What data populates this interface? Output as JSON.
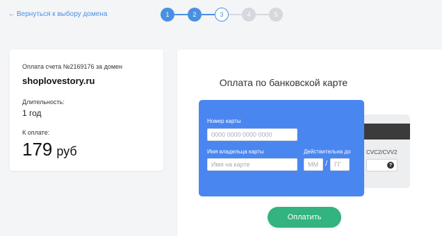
{
  "header": {
    "back_arrow": "←",
    "back_label": "Вернуться к выбору домена"
  },
  "stepper": {
    "steps": [
      {
        "label": "1",
        "state": "done"
      },
      {
        "label": "2",
        "state": "done"
      },
      {
        "label": "3",
        "state": "current"
      },
      {
        "label": "4",
        "state": "future"
      },
      {
        "label": "5",
        "state": "future"
      }
    ],
    "current_step": 3
  },
  "summary": {
    "invoice_text": "Оплата счета №2169176 за домен",
    "domain": "shoplovestory.ru",
    "duration_label": "Длительность:",
    "duration_value": "1 год",
    "to_pay_label": "К оплате:",
    "amount": "179",
    "currency": "руб"
  },
  "payment": {
    "title": "Оплата по банковской карте",
    "card_number_label": "Номер карты",
    "card_number_placeholder": "0000 0000 0000 0000",
    "holder_label": "Имя владельца карты",
    "holder_placeholder": "Имя на карте",
    "valid_label": "Действительна до",
    "month_placeholder": "ММ",
    "separator": "/",
    "year_placeholder": "ГГ",
    "cvc_label": "CVC2/CVV2",
    "help_glyph": "?",
    "pay_button": "Оплатить"
  },
  "colors": {
    "accent": "#4a90e2",
    "card_front": "#4a86f0",
    "pay_button": "#33b37e",
    "step_inactive": "#d5d8dd"
  }
}
